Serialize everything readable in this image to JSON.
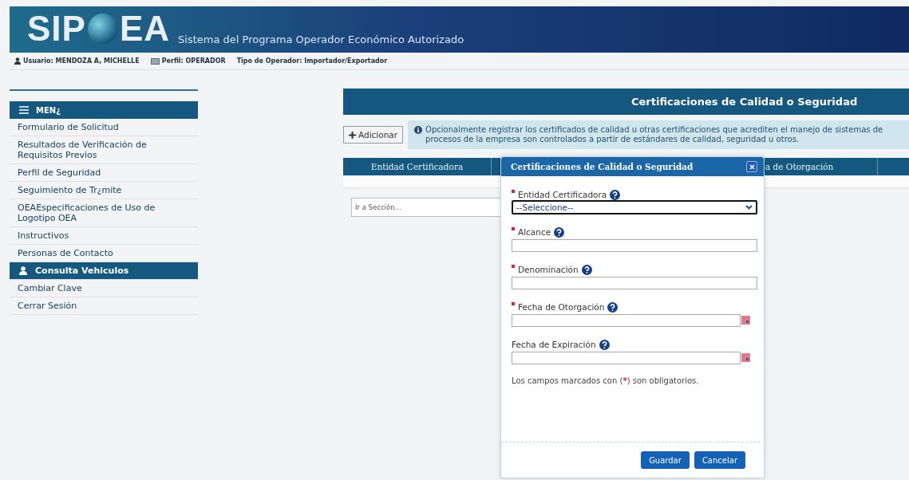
{
  "header": {
    "logo_left": "SIP",
    "logo_right": "EA",
    "subtitle": "Sistema del Programa Operador Económico Autorizado"
  },
  "user_bar": [
    {
      "kind": "user",
      "text": "Usuario: MENDOZA A, MICHELLE"
    },
    {
      "kind": "profile",
      "text": "Perfil: OPERADOR"
    },
    {
      "kind": "plain",
      "text": "Tipo de Operador: Importador/Exportador"
    }
  ],
  "sidebar": {
    "title": "MEN¿",
    "items": [
      {
        "label": "Formulario de Solicitud",
        "selected": false
      },
      {
        "label": "Resultados de Verificación de Requisitos Previos",
        "selected": false
      },
      {
        "label": "Perfil de Seguridad",
        "selected": false
      },
      {
        "label": "Seguimiento de Tr¿mite",
        "selected": false
      },
      {
        "label": "OEAEspecificaciones de Uso de Logotipo OEA",
        "selected": false
      },
      {
        "label": "Instructivos",
        "selected": false
      },
      {
        "label": "Personas de Contacto",
        "selected": false
      },
      {
        "label": "Consulta Vehiculos",
        "selected": true
      },
      {
        "label": "Cambiar Clave",
        "selected": false
      },
      {
        "label": "Cerrar Sesión",
        "selected": false
      }
    ]
  },
  "main": {
    "title": "Certificaciones de Calidad o Seguridad",
    "add_button": "Adicionar",
    "info": "Opcionalmente registrar los certificados de calidad u otras certificaciones que acrediten el manejo de sistemas de procesos de la empresa son controlados a partir de estándares de calidad, seguridad u otros.",
    "table": {
      "columns": [
        "Entidad Certificadora",
        "a de Otorgación"
      ]
    },
    "section_select": {
      "value": "Ir a Sección..."
    }
  },
  "modal": {
    "title": "Certificaciones de Calidad o Seguridad",
    "fields": [
      {
        "kind": "select",
        "label": "Entidad Certificadora",
        "required": true,
        "value": "--Seleccione--"
      },
      {
        "kind": "text",
        "label": "Alcance",
        "required": true
      },
      {
        "kind": "text",
        "label": "Denominación",
        "required": true
      },
      {
        "kind": "date",
        "label": "Fecha de Otorgación",
        "required": true
      },
      {
        "kind": "date",
        "label": "Fecha de Expiración",
        "required": false
      }
    ],
    "note": {
      "before": "Los campos marcados con (",
      "mark": "*",
      "after": ") son obligatorios."
    },
    "buttons": [
      "Guardar",
      "Cancelar"
    ]
  }
}
